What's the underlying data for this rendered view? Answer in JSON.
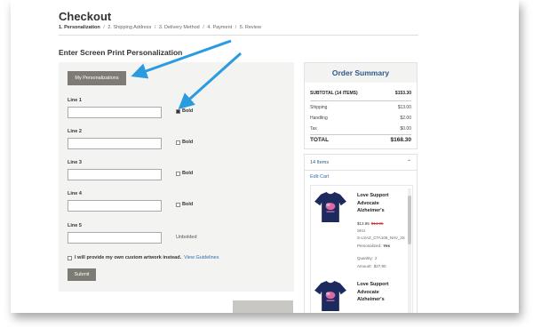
{
  "page": {
    "title": "Checkout",
    "steps": [
      "1. Personalization",
      "2. Shipping Address",
      "3. Delivery Method",
      "4. Payment",
      "5. Review"
    ],
    "step_separator": "/",
    "heading": "Enter Screen Print Personalization"
  },
  "form": {
    "my_personalizations_label": "My Personalizations",
    "lines": [
      {
        "label": "Line 1",
        "value": "",
        "option": "Bold",
        "checked": true
      },
      {
        "label": "Line 2",
        "value": "",
        "option": "Bold",
        "checked": false
      },
      {
        "label": "Line 3",
        "value": "",
        "option": "Bold",
        "checked": false
      },
      {
        "label": "Line 4",
        "value": "",
        "option": "Bold",
        "checked": false
      },
      {
        "label": "Line 5",
        "value": "",
        "option": "Unbolded"
      }
    ],
    "artwork_text": "I will provide my own custom artwork instead.",
    "artwork_link": "View Guidelines",
    "submit_label": "Submit"
  },
  "summary": {
    "title": "Order Summary",
    "subtotal_label": "SUBTOTAL (14 ITEMS)",
    "subtotal_value": "$153.30",
    "shipping_label": "Shipping",
    "shipping_value": "$13.00",
    "handling_label": "Handling",
    "handling_value": "$2.00",
    "tax_label": "Tax",
    "tax_value": "$0.00",
    "total_label": "TOTAL",
    "total_value": "$168.30"
  },
  "cart": {
    "items_label": "14 Items",
    "edit_cart": "Edit Cart",
    "products": [
      {
        "name": "Love Support Advocate Alzheimer's",
        "price": "$13.95",
        "old_price": "$14.95",
        "sku_label": "SKU",
        "sku": "S-LSAZ_CTA106_NAV_3X",
        "personalized_label": "Personalized:",
        "personalized_value": "Yes",
        "quantity_label": "Quantity:",
        "quantity": "2",
        "amount_label": "Amount:",
        "amount": "$27.90"
      },
      {
        "name": "Love Support Advocate Alzheimer's"
      }
    ]
  },
  "colors": {
    "accent_blue": "#2e5a8c",
    "link_blue": "#2d6db4",
    "button_gray": "#7d7b74",
    "panel_bg": "#f3f3f1",
    "arrow_blue": "#2b9be0",
    "shirt_navy": "#1c2a5e",
    "shirt_print_pink": "#d86aa6"
  },
  "icons": {
    "arrow": "annotation-arrow",
    "collapse": "chevron-up-icon",
    "checkbox": "checkbox-icon",
    "product": "tshirt-image"
  }
}
